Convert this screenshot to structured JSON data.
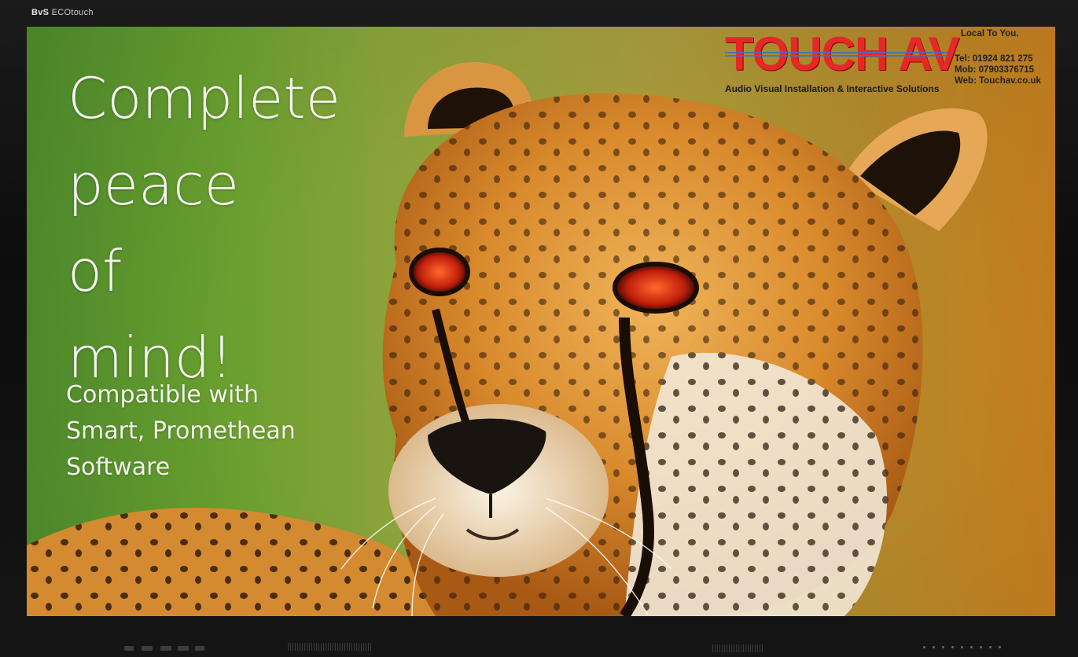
{
  "device": {
    "brand_prefix": "BvS",
    "brand_name": "ECOtouch"
  },
  "headline": [
    "Complete",
    "peace",
    "of",
    "mind!"
  ],
  "subheadline": [
    "Compatible with",
    "Smart, Promethean",
    "Software"
  ],
  "logo": {
    "name": "TOUCH AV",
    "tagline": "Audio Visual Installation & Interactive Solutions"
  },
  "contact": {
    "local": "Local To You.",
    "tel": "Tel: 01924 821 275",
    "mob": "Mob: 07903376715",
    "web": "Web: Touchav.co.uk"
  },
  "colors": {
    "logo_red": "#e42828",
    "logo_blue_lines": "#3a6fd0",
    "headline_text": "#f4f4ef",
    "bezel": "#141414"
  },
  "icons": [
    "cheetah-photo",
    "front-panel-buttons",
    "speaker-grille",
    "status-leds"
  ]
}
